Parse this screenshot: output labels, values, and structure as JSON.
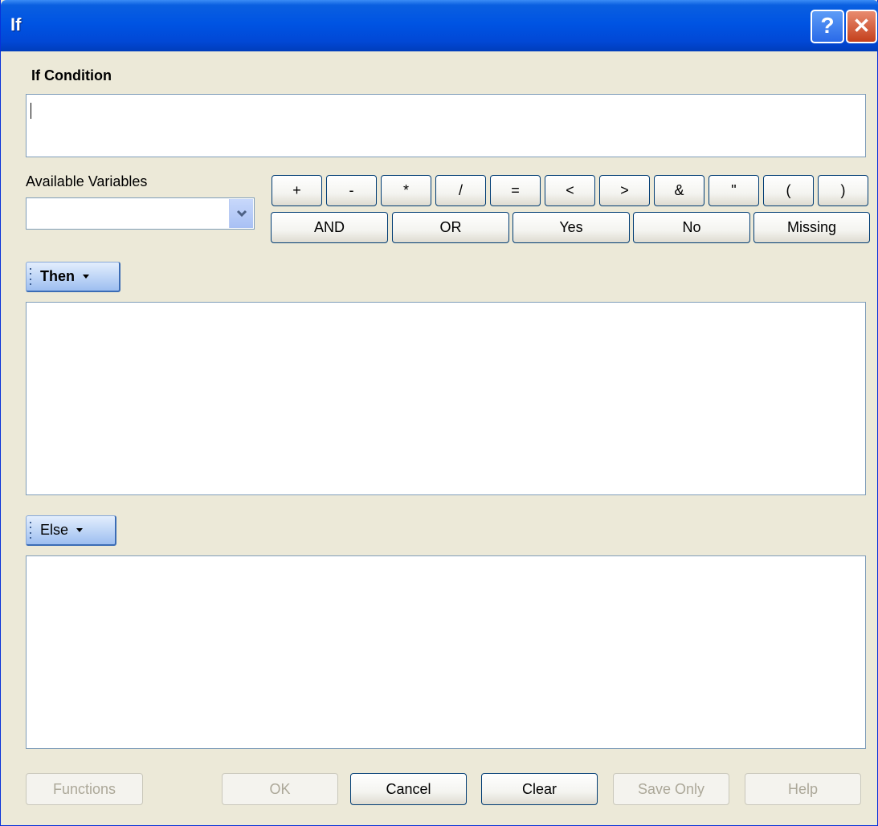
{
  "window": {
    "title": "If",
    "help_glyph": "?",
    "close_glyph": "✕"
  },
  "condition": {
    "label": "If Condition",
    "value": ""
  },
  "variables": {
    "label": "Available Variables",
    "selected": ""
  },
  "operators": [
    "+",
    "-",
    "*",
    "/",
    "=",
    "<",
    ">",
    "&",
    "\"",
    "(",
    ")"
  ],
  "logic_buttons": [
    "AND",
    "OR",
    "Yes",
    "No",
    "Missing"
  ],
  "then_section": {
    "label": "Then",
    "value": ""
  },
  "else_section": {
    "label": "Else",
    "value": ""
  },
  "footer": {
    "functions": "Functions",
    "ok": "OK",
    "cancel": "Cancel",
    "clear": "Clear",
    "save_only": "Save Only",
    "help": "Help"
  },
  "colors": {
    "titlebar": "#0054e3",
    "window_bg": "#ece9d8",
    "button_border": "#003c74",
    "disabled_text": "#aca899"
  }
}
